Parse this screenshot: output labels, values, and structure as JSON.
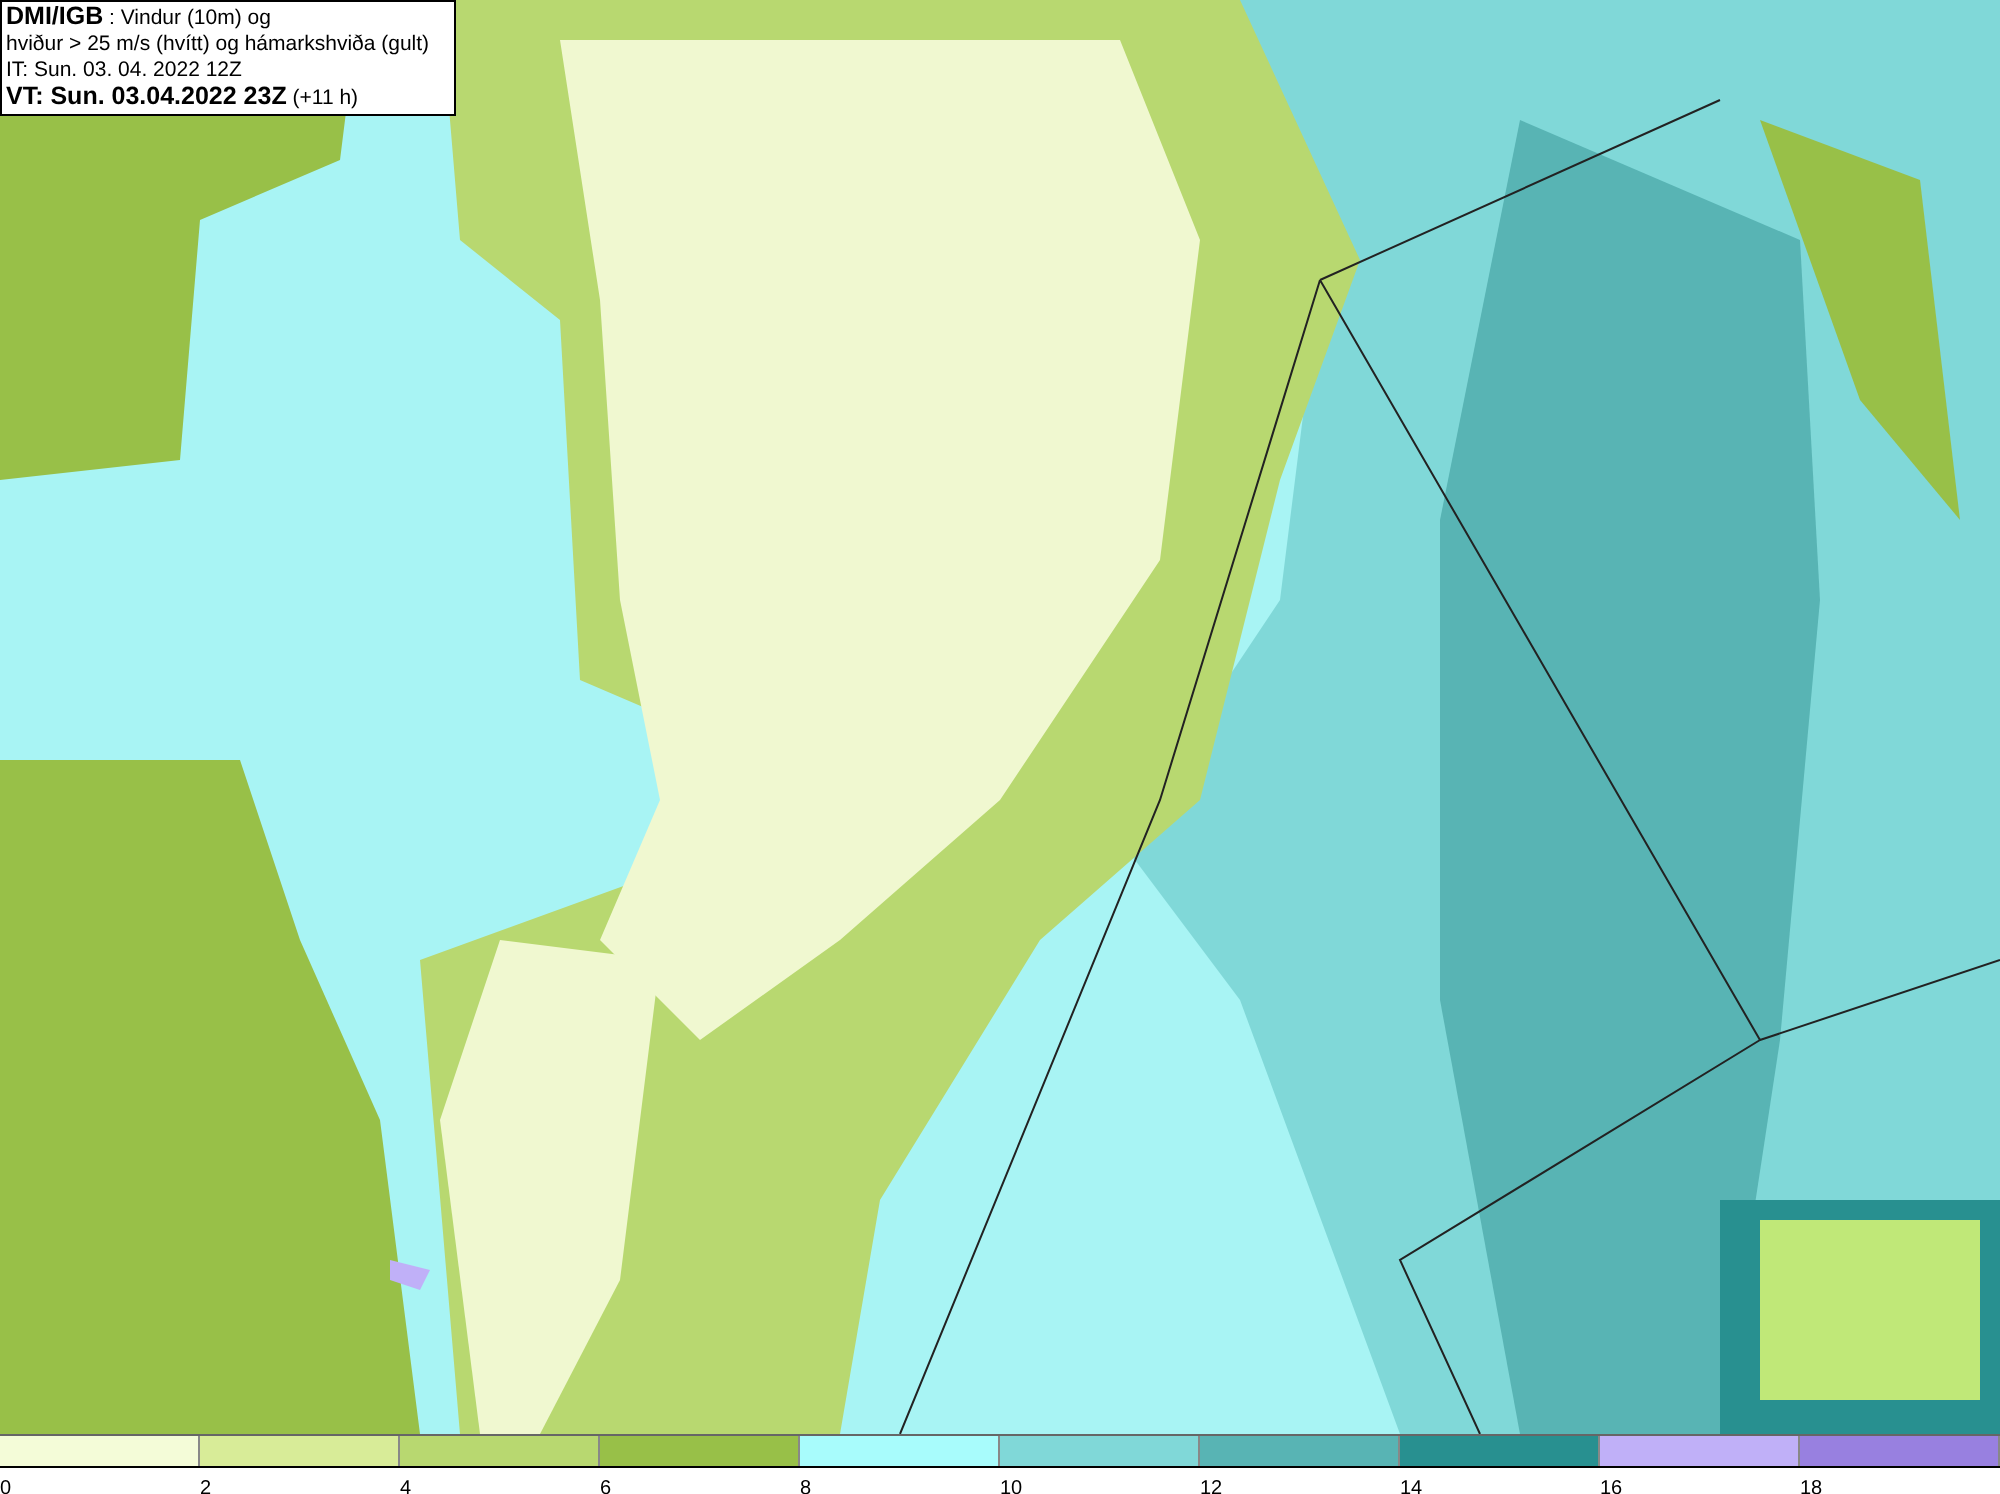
{
  "header": {
    "lines": [
      "**DMI/IGB** : Vindur (10m) og",
      "hviður > 25 m/s (hvítt) og hámarkshviða (gult)",
      "IT: Sun. 03. 04. 2022 12Z",
      "**VT: Sun. 03.04.2022 23Z** (+11 h)"
    ]
  },
  "legend": {
    "bins": [
      {
        "label": "0",
        "color": "#f4fcd8"
      },
      {
        "label": "2",
        "color": "#d8ec98"
      },
      {
        "label": "4",
        "color": "#b8d870"
      },
      {
        "label": "6",
        "color": "#98c048"
      },
      {
        "label": "8",
        "color": "#a8fcfc"
      },
      {
        "label": "10",
        "color": "#80d8d8"
      },
      {
        "label": "12",
        "color": "#58b4b4"
      },
      {
        "label": "14",
        "color": "#289090"
      },
      {
        "label": "16",
        "color": "#c0b0f8"
      },
      {
        "label": "18",
        "color": "#9880e0"
      }
    ]
  }
}
